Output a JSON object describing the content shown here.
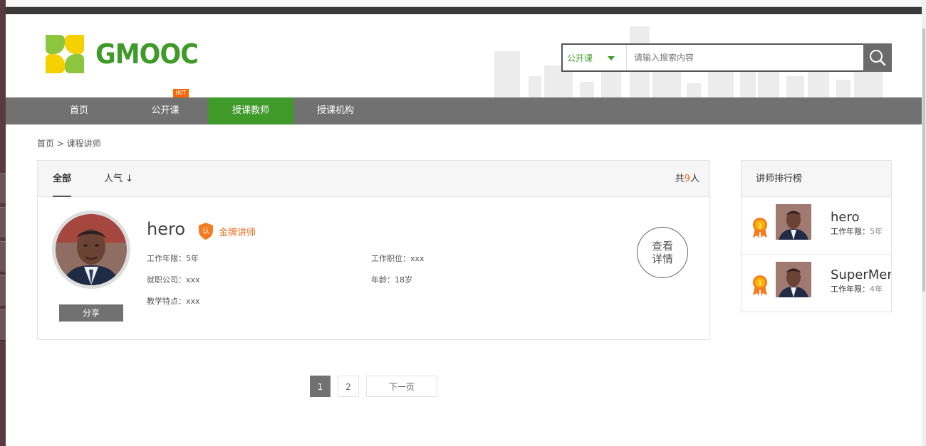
{
  "brand": {
    "logo_text": "GMOOC"
  },
  "search": {
    "category": "公开课",
    "placeholder": "请输入搜索内容"
  },
  "nav": {
    "items": [
      {
        "label": "首页"
      },
      {
        "label": "公开课",
        "badge": "HOT"
      },
      {
        "label": "授课教师",
        "active": true
      },
      {
        "label": "授课机构"
      }
    ]
  },
  "breadcrumb": "首页 > 课程讲师",
  "list": {
    "tabs": [
      {
        "label": "全部",
        "active": true
      },
      {
        "label": "人气 ↓"
      }
    ],
    "total_prefix": "共",
    "total_count": "9",
    "total_suffix": "人"
  },
  "teacher": {
    "name": "hero",
    "badge_icon_text": "认",
    "badge_label": "金牌讲师",
    "share_label": "分享",
    "fields": {
      "years": "工作年限：5年",
      "position": "工作职位：xxx",
      "company": "就职公司：xxx",
      "age": "年龄：18岁",
      "feature": "教学特点：xxx"
    },
    "detail_line1": "查看",
    "detail_line2": "详情"
  },
  "pagination": {
    "pages": [
      "1",
      "2"
    ],
    "next": "下一页",
    "current": "1"
  },
  "ranking": {
    "title": "讲师排行榜",
    "items": [
      {
        "rank": "1",
        "name": "hero",
        "years_label": "工作年限：",
        "years_value": "5年"
      },
      {
        "rank": "1",
        "name": "SuperMen",
        "years_label": "工作年限：",
        "years_value": "4年"
      }
    ]
  },
  "colors": {
    "accent_green": "#3f9a2a",
    "nav_gray": "#717171",
    "orange": "#e96a1c",
    "hot": "#ff6600"
  }
}
